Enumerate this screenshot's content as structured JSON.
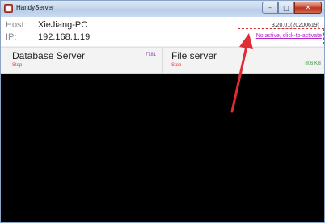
{
  "window": {
    "title": "HandyServer",
    "caption": {
      "minimize_glyph": "–",
      "maximize_glyph": "□",
      "close_glyph": "✕"
    }
  },
  "host": {
    "host_label": "Host:",
    "host_value": "XieJiang-PC",
    "ip_label": "IP:",
    "ip_value": "192.168.1.19"
  },
  "version": "3.20.01(20200619)",
  "activation": {
    "link_text": "No active, click-to-activate"
  },
  "servers": {
    "database": {
      "title": "Database Server",
      "status": "Stop",
      "value": "7781"
    },
    "file": {
      "title": "File server",
      "status": "Stop",
      "value": "806 KB"
    }
  },
  "colors": {
    "annotation_red": "#e02c34",
    "activate_link": "#b524c9",
    "status_stop": "#e03a3a",
    "console_bg": "#000000"
  }
}
